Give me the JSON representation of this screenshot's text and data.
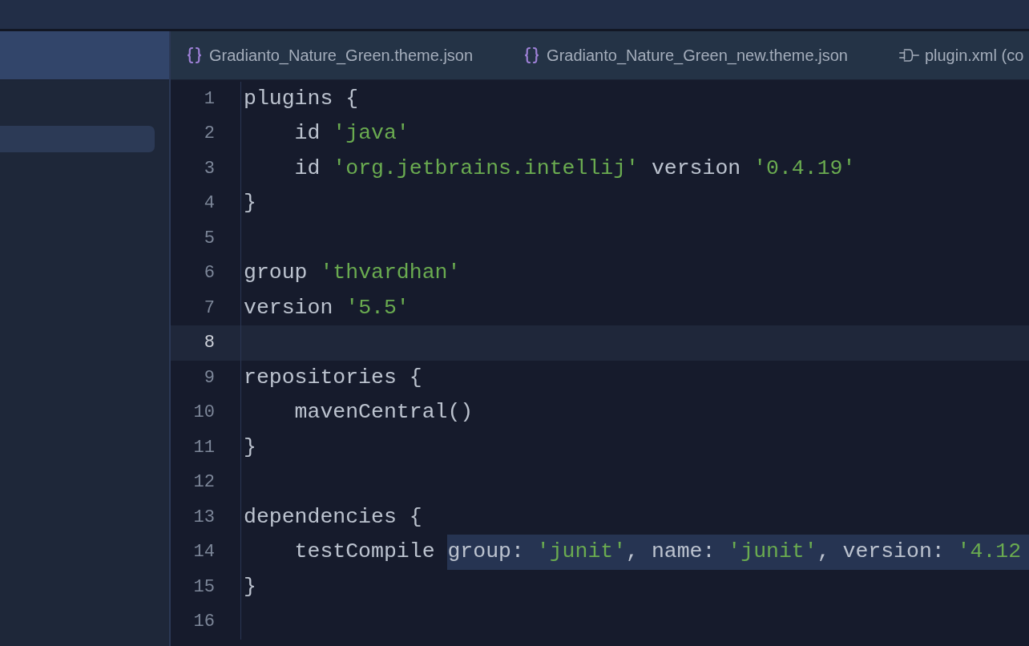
{
  "tabs": [
    {
      "label": "Gradianto_Nature_Green.theme.json",
      "kind": "json"
    },
    {
      "label": "Gradianto_Nature_Green_new.theme.json",
      "kind": "json"
    },
    {
      "label": "plugin.xml (co",
      "kind": "plugin"
    }
  ],
  "sidebar": {
    "items": [
      {
        "selected": true
      }
    ]
  },
  "editor": {
    "lines": [
      {
        "number": "1",
        "current": false,
        "tokens": [
          {
            "text": "plugins {",
            "kind": "plain"
          }
        ]
      },
      {
        "number": "2",
        "current": false,
        "tokens": [
          {
            "text": "    id ",
            "kind": "plain"
          },
          {
            "text": "'java'",
            "kind": "string"
          }
        ]
      },
      {
        "number": "3",
        "current": false,
        "tokens": [
          {
            "text": "    id ",
            "kind": "plain"
          },
          {
            "text": "'org.jetbrains.intellij'",
            "kind": "string"
          },
          {
            "text": " version ",
            "kind": "plain"
          },
          {
            "text": "'0.4.19'",
            "kind": "string"
          }
        ]
      },
      {
        "number": "4",
        "current": false,
        "tokens": [
          {
            "text": "}",
            "kind": "plain"
          }
        ]
      },
      {
        "number": "5",
        "current": false
      },
      {
        "number": "6",
        "current": false,
        "tokens": [
          {
            "text": "group ",
            "kind": "plain"
          },
          {
            "text": "'thvardhan'",
            "kind": "string"
          }
        ]
      },
      {
        "number": "7",
        "current": false,
        "tokens": [
          {
            "text": "version ",
            "kind": "plain"
          },
          {
            "text": "'5.5'",
            "kind": "string"
          }
        ]
      },
      {
        "number": "8",
        "current": true
      },
      {
        "number": "9",
        "current": false,
        "tokens": [
          {
            "text": "repositories {",
            "kind": "plain"
          }
        ]
      },
      {
        "number": "10",
        "current": false,
        "tokens": [
          {
            "text": "    mavenCentral()",
            "kind": "plain"
          }
        ]
      },
      {
        "number": "11",
        "current": false,
        "tokens": [
          {
            "text": "}",
            "kind": "plain"
          }
        ]
      },
      {
        "number": "12",
        "current": false
      },
      {
        "number": "13",
        "current": false,
        "tokens": [
          {
            "text": "dependencies {",
            "kind": "plain"
          }
        ]
      },
      {
        "number": "14",
        "current": false,
        "tokens": [
          {
            "text": "    testCompile ",
            "kind": "plain"
          }
        ],
        "selection": [
          {
            "text": "group: ",
            "kind": "plain"
          },
          {
            "text": "'junit'",
            "kind": "string"
          },
          {
            "text": ", name: ",
            "kind": "plain"
          },
          {
            "text": "'junit'",
            "kind": "string"
          },
          {
            "text": ", version: ",
            "kind": "plain"
          },
          {
            "text": "'4.12",
            "kind": "string"
          }
        ]
      },
      {
        "number": "15",
        "current": false,
        "tokens": [
          {
            "text": "}",
            "kind": "plain"
          }
        ]
      },
      {
        "number": "16",
        "current": false
      }
    ]
  }
}
